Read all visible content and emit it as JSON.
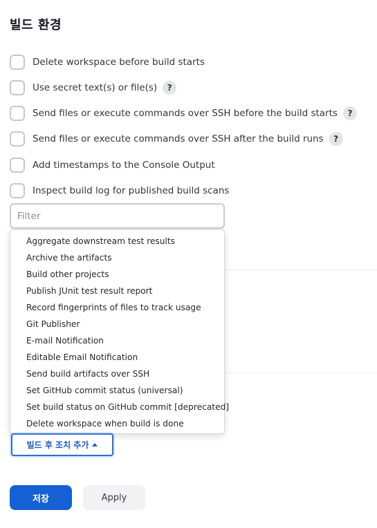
{
  "section_title": "빌드 환경",
  "options": [
    {
      "label": "Delete workspace before build starts",
      "checked": false,
      "help": ""
    },
    {
      "label": "Use secret text(s) or file(s)",
      "checked": false,
      "help": "?"
    },
    {
      "label": "Send files or execute commands over SSH before the build starts",
      "checked": false,
      "help": "?"
    },
    {
      "label": "Send files or execute commands over SSH after the build runs",
      "checked": false,
      "help": "?"
    },
    {
      "label": "Add timestamps to the Console Output",
      "checked": false,
      "help": ""
    },
    {
      "label": "Inspect build log for published build scans",
      "checked": false,
      "help": ""
    }
  ],
  "filter": {
    "placeholder": "Filter",
    "value": ""
  },
  "dropdown_items": [
    "Aggregate downstream test results",
    "Archive the artifacts",
    "Build other projects",
    "Publish JUnit test result report",
    "Record fingerprints of files to track usage",
    "Git Publisher",
    "E-mail Notification",
    "Editable Email Notification",
    "Send build artifacts over SSH",
    "Set GitHub commit status (universal)",
    "Set build status on GitHub commit [deprecated]",
    "Delete workspace when build is done"
  ],
  "add_post_build_label": "빌드 후 조치 추가",
  "save_label": "저장",
  "apply_label": "Apply",
  "colors": {
    "primary": "#1560d4",
    "outline": "#2b6fd6"
  }
}
